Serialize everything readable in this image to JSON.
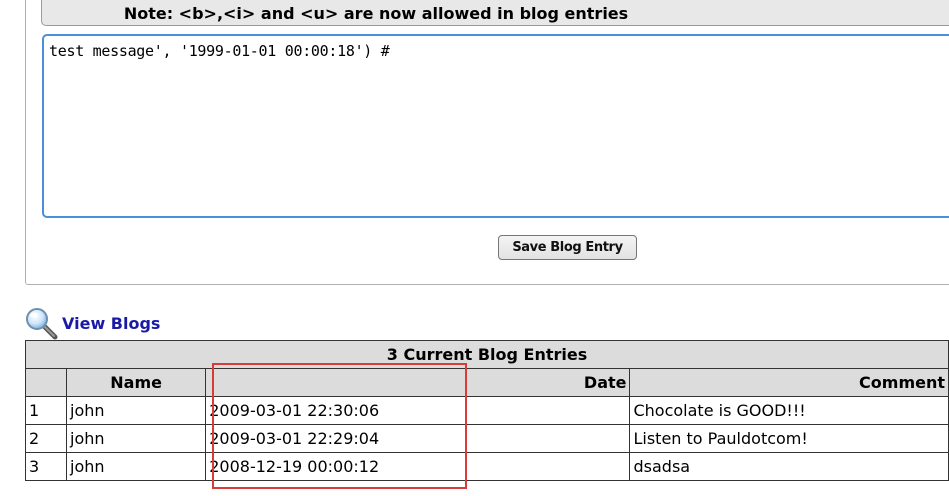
{
  "form": {
    "note": "Note: <b>,<i> and <u> are now allowed in blog entries",
    "textarea_value": "test message', '1999-01-01 00:00:18') #",
    "save_label": "Save Blog Entry"
  },
  "view_blogs": {
    "icon": "magnifier-icon",
    "link_label": "View Blogs"
  },
  "entries_table": {
    "caption": "3 Current Blog Entries",
    "headers": {
      "num": "",
      "name": "Name",
      "date": "Date",
      "comment": "Comment"
    },
    "rows": [
      {
        "num": "1",
        "name": "john",
        "date": "2009-03-01 22:30:06",
        "comment": "Chocolate is GOOD!!!"
      },
      {
        "num": "2",
        "name": "john",
        "date": "2009-03-01 22:29:04",
        "comment": "Listen to Pauldotcom!"
      },
      {
        "num": "3",
        "name": "john",
        "date": "2008-12-19 00:00:12",
        "comment": "dsadsa"
      }
    ]
  },
  "annotation": {
    "highlight_color": "#d93a3a"
  }
}
